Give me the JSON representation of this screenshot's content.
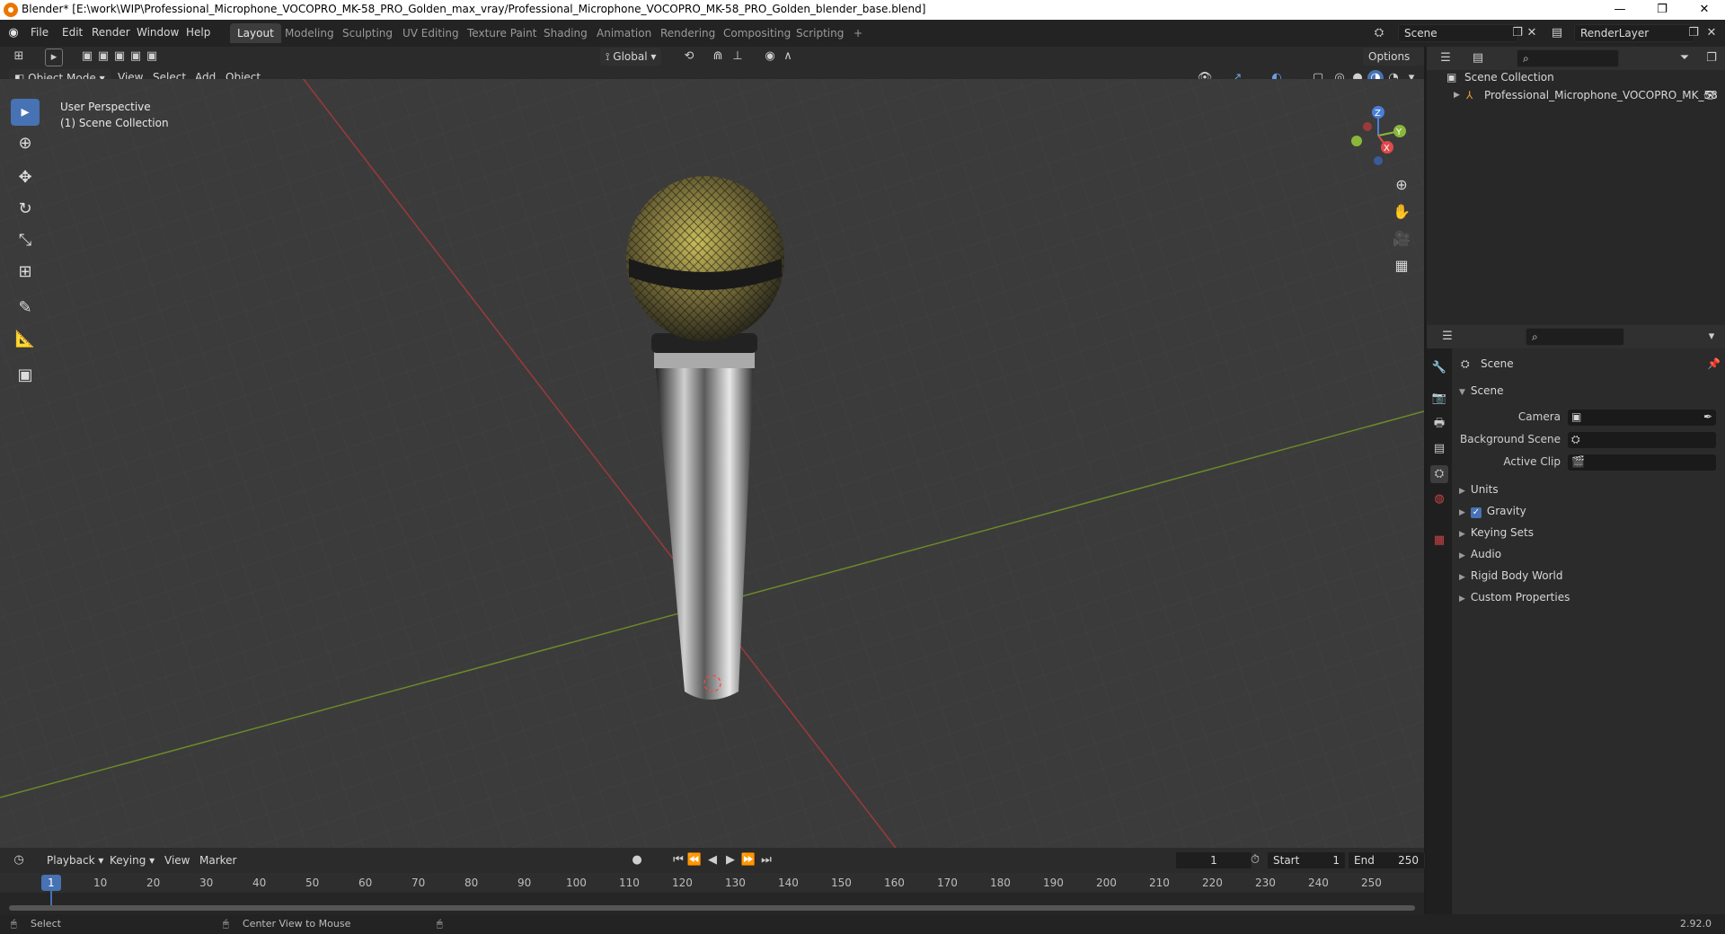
{
  "window": {
    "title": "Blender* [E:\\work\\WIP\\Professional_Microphone_VOCOPRO_MK-58_PRO_Golden_max_vray/Professional_Microphone_VOCOPRO_MK-58_PRO_Golden_blender_base.blend]",
    "minimize": "—",
    "restore": "❐",
    "close": "✕"
  },
  "menu": [
    "File",
    "Edit",
    "Render",
    "Window",
    "Help"
  ],
  "workspaces": [
    "Layout",
    "Modeling",
    "Sculpting",
    "UV Editing",
    "Texture Paint",
    "Shading",
    "Animation",
    "Rendering",
    "Compositing",
    "Scripting"
  ],
  "workspace_add": "+",
  "scene_field": "Scene",
  "renderlayer_field": "RenderLayer",
  "viewport": {
    "mode": "Object Mode",
    "menus": [
      "View",
      "Select",
      "Add",
      "Object"
    ],
    "transform_orientation": "Global",
    "options": "Options",
    "overlay_line1": "User Perspective",
    "overlay_line2": "(1) Scene Collection",
    "gizmo": {
      "z": "Z",
      "y": "Y",
      "x": "X"
    }
  },
  "outliner": {
    "root": "Scene Collection",
    "item": "Professional_Microphone_VOCOPRO_MK_58"
  },
  "properties": {
    "context": "Scene",
    "panel": "Scene",
    "labels": {
      "camera": "Camera",
      "background_scene": "Background Scene",
      "active_clip": "Active Clip"
    },
    "sections": [
      "Units",
      "Gravity",
      "Keying Sets",
      "Audio",
      "Rigid Body World",
      "Custom Properties"
    ],
    "gravity_checked": true
  },
  "timeline": {
    "menus": [
      "Playback",
      "Keying",
      "View",
      "Marker"
    ],
    "current_frame": "1",
    "start_label": "Start",
    "start_value": "1",
    "end_label": "End",
    "end_value": "250",
    "ticks": [
      "1",
      "10",
      "20",
      "30",
      "40",
      "50",
      "60",
      "70",
      "80",
      "90",
      "100",
      "110",
      "120",
      "130",
      "140",
      "150",
      "160",
      "170",
      "180",
      "190",
      "200",
      "210",
      "220",
      "230",
      "240",
      "250"
    ]
  },
  "status": {
    "left": "Select",
    "middle": "Center View to Mouse",
    "version": "2.92.0"
  }
}
